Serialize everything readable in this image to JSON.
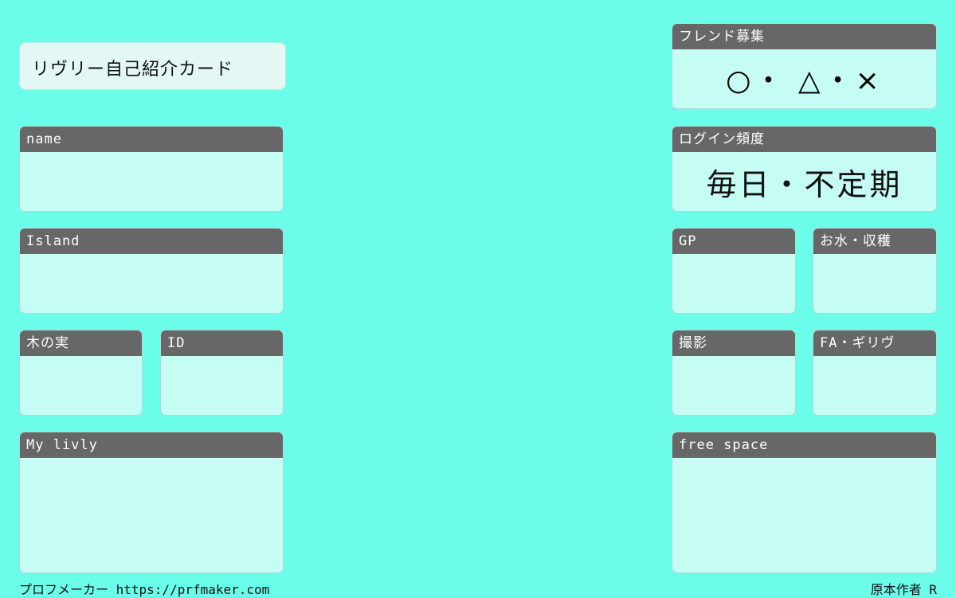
{
  "title": "リヴリー自己紹介カード",
  "cards": {
    "name": {
      "label": "name",
      "value": ""
    },
    "island": {
      "label": "Island",
      "value": ""
    },
    "nuts": {
      "label": "木の実",
      "value": ""
    },
    "id": {
      "label": "ID",
      "value": ""
    },
    "my_livly": {
      "label": "My livly",
      "value": ""
    },
    "friend": {
      "label": "フレンド募集",
      "value": "○・ △・×"
    },
    "login": {
      "label": "ログイン頻度",
      "value": "毎日・不定期"
    },
    "gp": {
      "label": "GP",
      "value": ""
    },
    "water": {
      "label": "お水・収穫",
      "value": ""
    },
    "photo": {
      "label": "撮影",
      "value": ""
    },
    "fa": {
      "label": "FA・ギリヴ",
      "value": ""
    },
    "free_space": {
      "label": "free space",
      "value": ""
    }
  },
  "footer": {
    "left": "プロフメーカー https://prfmaker.com",
    "right": "原本作者 R"
  },
  "colors": {
    "background": "#6cfdea",
    "card_body": "#c5fdf4",
    "card_header": "#676767",
    "title_box": "#e3f8f5"
  }
}
